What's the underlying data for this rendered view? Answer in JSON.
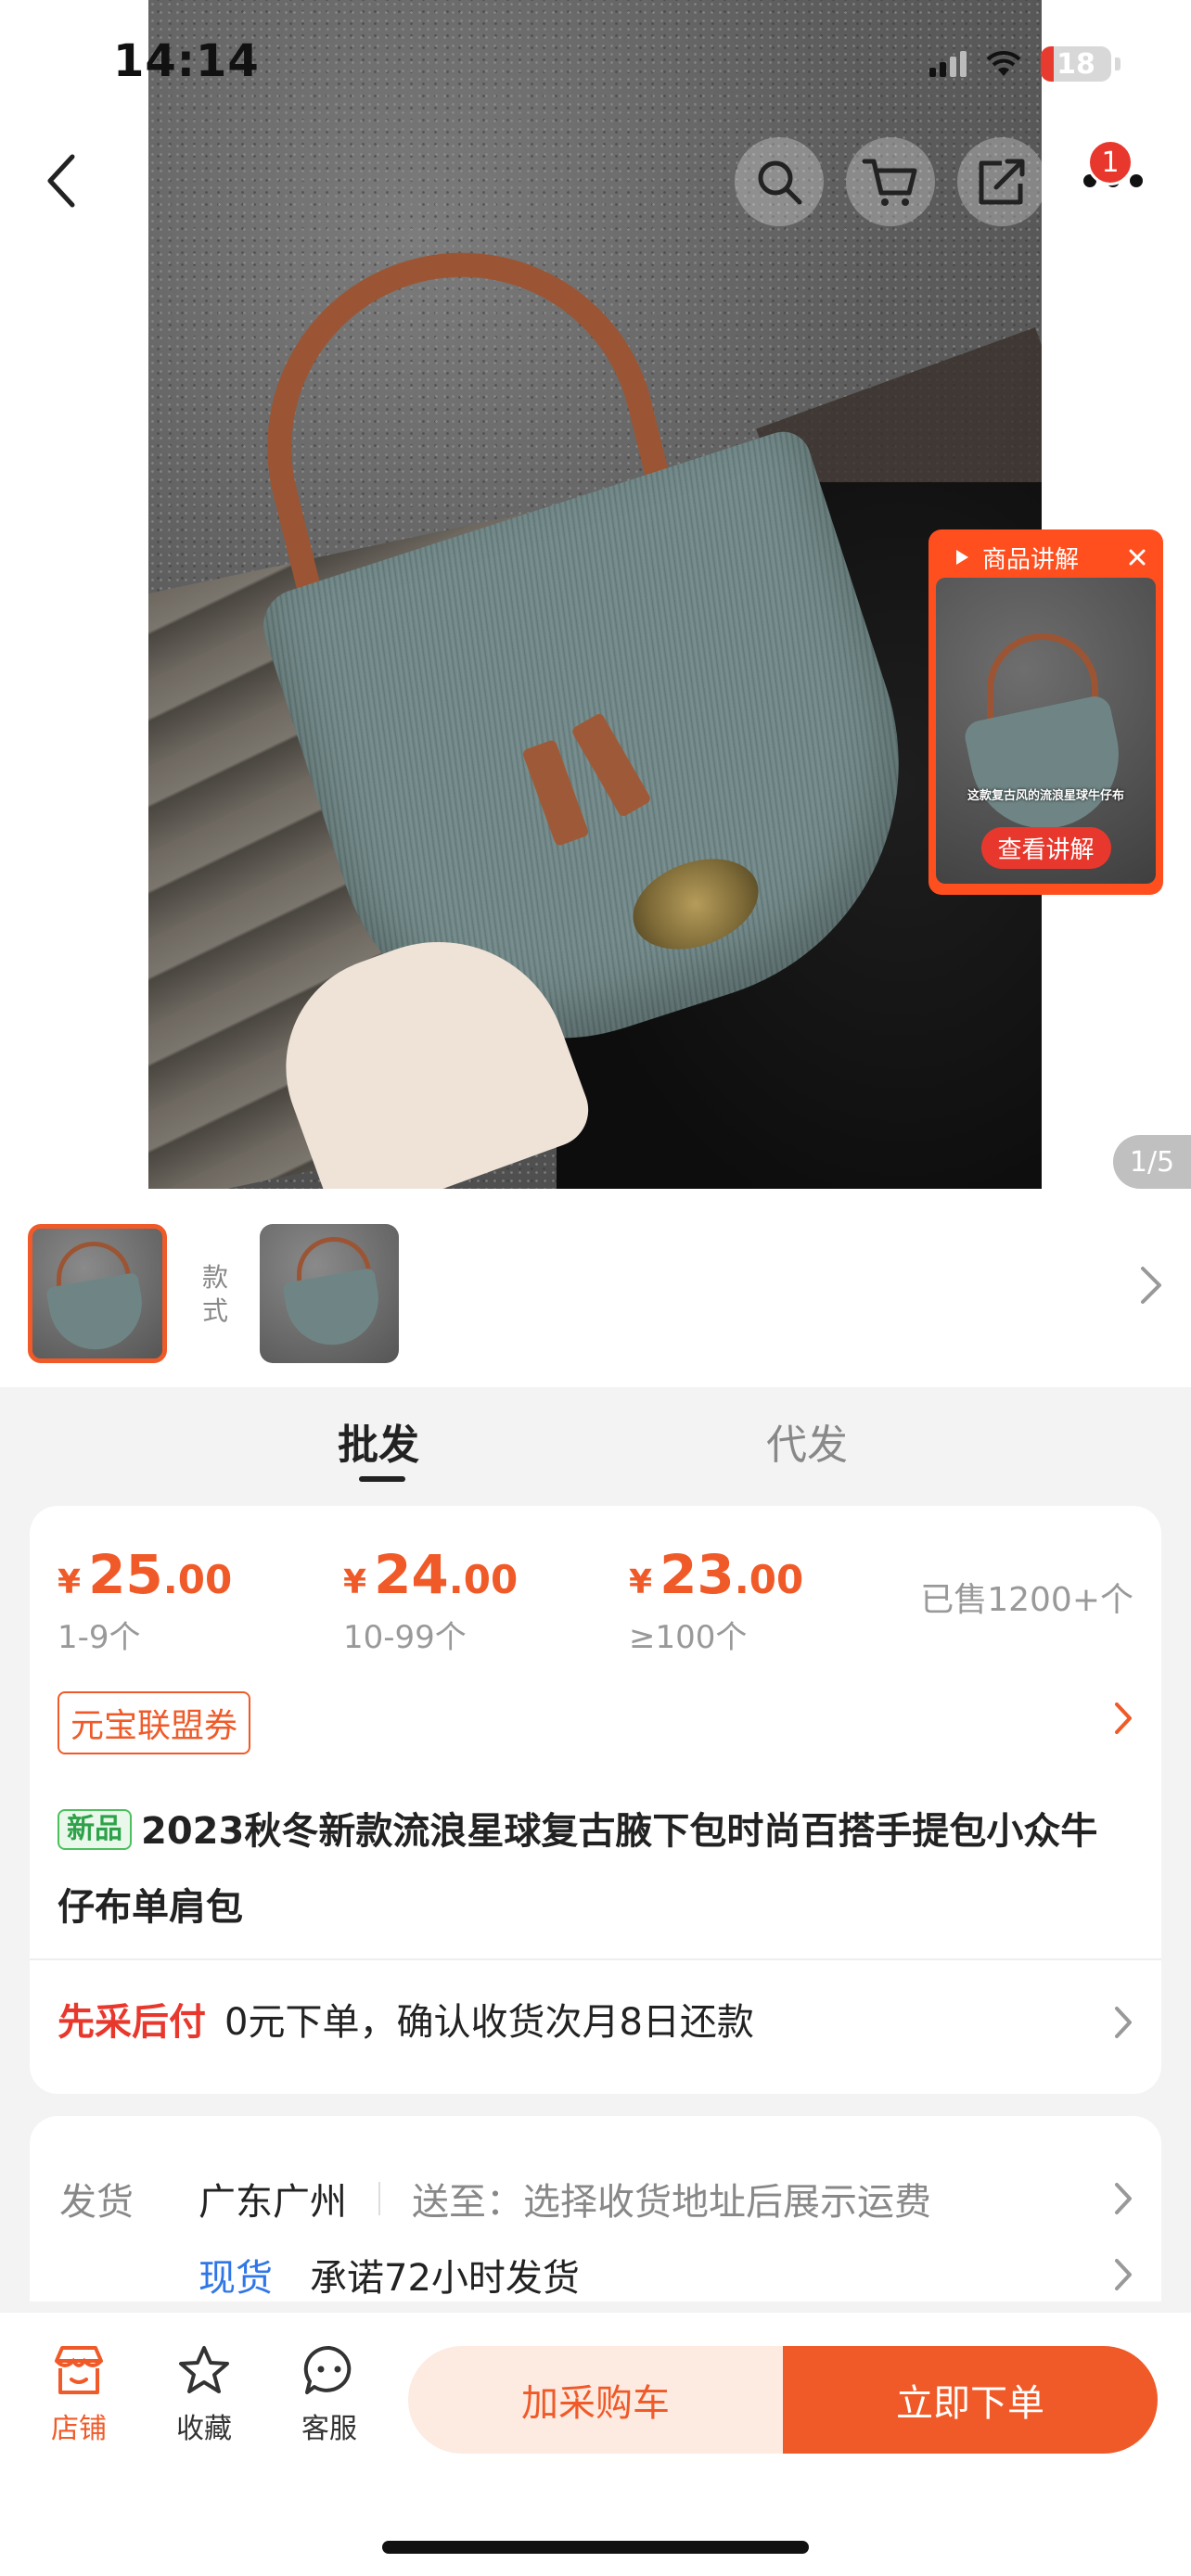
{
  "status_bar": {
    "time": "14:14",
    "battery": "18",
    "battery_level": 0.18
  },
  "nav": {
    "back_icon": "chevron-left-icon",
    "search_icon": "search-icon",
    "cart_icon": "cart-icon",
    "share_icon": "share-icon",
    "more_icon": "more-icon",
    "badge_count": "1"
  },
  "live_card": {
    "title": "商品讲解",
    "caption": "这款复古风的流浪星球牛仔布",
    "button": "查看讲解"
  },
  "gallery": {
    "counter": "1/5"
  },
  "variants": {
    "label": "款式"
  },
  "tabs": [
    {
      "label": "批发",
      "active": true
    },
    {
      "label": "代发",
      "active": false
    }
  ],
  "prices": [
    {
      "yen": "¥",
      "int": "25",
      "dec": ".00",
      "qty": "1-9个"
    },
    {
      "yen": "¥",
      "int": "24",
      "dec": ".00",
      "qty": "10-99个"
    },
    {
      "yen": "¥",
      "int": "23",
      "dec": ".00",
      "qty": "≥100个"
    }
  ],
  "sold": "已售1200+个",
  "coupon": "元宝联盟券",
  "product": {
    "tag": "新品",
    "title": "2023秋冬新款流浪星球复古腋下包时尚百搭手提包小众牛仔布单肩包"
  },
  "pay_later": {
    "label": "先采后付",
    "text": "0元下单，确认收货次月8日还款"
  },
  "shipping": {
    "label": "发货",
    "origin": "广东广州",
    "dest": "送至：选择收货地址后展示运费",
    "stock": "现货",
    "promise": "承诺72小时发货"
  },
  "bottom_bar": {
    "store": "店铺",
    "favorite": "收藏",
    "service": "客服",
    "add_cart": "加采购车",
    "buy_now": "立即下单"
  },
  "colors": {
    "accent": "#f05a28",
    "red": "#e8382d",
    "blue": "#2f76e8",
    "green": "#2ea24a"
  }
}
